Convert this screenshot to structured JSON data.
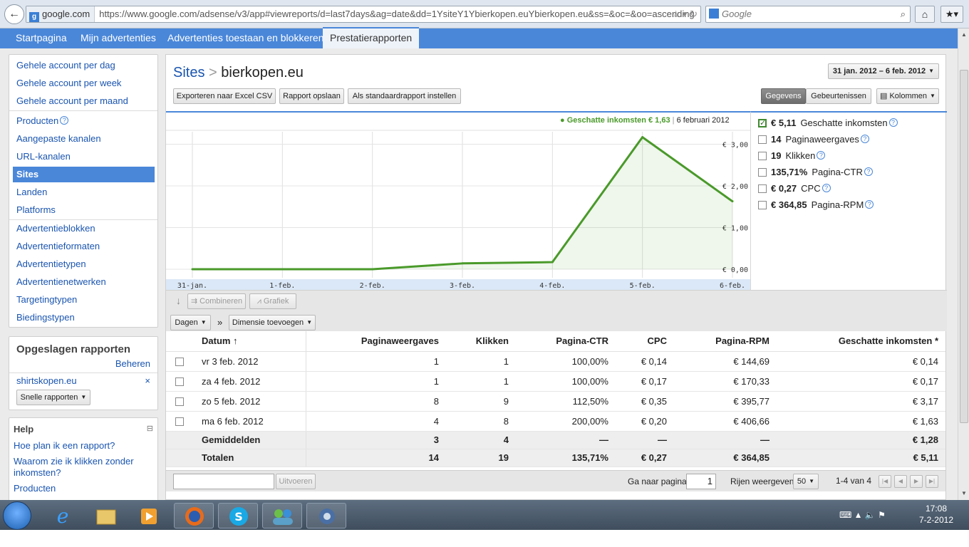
{
  "browser": {
    "site": "google.com",
    "url": "https://www.google.com/adsense/v3/app#viewreports/d=last7days&ag=date&dd=1YsiteY1Ybierkopen.euYbierkopen.eu&ss=&oc=&oo=ascending",
    "search_placeholder": "Google"
  },
  "nav": {
    "tabs": [
      "Startpagina",
      "Mijn advertenties",
      "Advertenties toestaan en blokkeren",
      "Prestatierapporten"
    ]
  },
  "sidebar": {
    "group1": [
      "Gehele account per dag",
      "Gehele account per week",
      "Gehele account per maand"
    ],
    "group2": [
      "Producten",
      "Aangepaste kanalen",
      "URL-kanalen",
      "Sites",
      "Landen",
      "Platforms"
    ],
    "group3": [
      "Advertentieblokken",
      "Advertentieformaten",
      "Advertentietypen",
      "Advertentienetwerken",
      "Targetingtypen",
      "Biedingstypen"
    ]
  },
  "saved": {
    "title": "Opgeslagen rapporten",
    "manage": "Beheren",
    "item": "shirtskopen.eu",
    "remove": "×",
    "quick": "Snelle rapporten"
  },
  "help": {
    "title": "Help",
    "collapse": "⊟",
    "links": [
      "Hoe plan ik een rapport?",
      "Waarom zie ik klikken zonder inkomsten?",
      "Producten"
    ]
  },
  "report": {
    "crumb_root": "Sites",
    "crumb_sep": ">",
    "crumb_current": "bierkopen.eu",
    "date_range": "31 jan. 2012 – 6 feb. 2012",
    "buttons": [
      "Exporteren naar Excel CSV",
      "Rapport opslaan",
      "Als standaardrapport instellen"
    ],
    "view_toggle": [
      "Gegevens",
      "Gebeurtenissen"
    ],
    "columns_btn": "Kolommen",
    "tooltip_series": "● Geschatte inkomsten € 1,63",
    "tooltip_date": "6 februari 2012",
    "combine": "Combineren",
    "graph": "Grafiek",
    "dim_days": "Dagen",
    "dim_add": "Dimensie toevoegen",
    "dim_sep": "»"
  },
  "metrics": [
    {
      "value": "€ 5,11",
      "label": "Geschatte inkomsten",
      "checked": true
    },
    {
      "value": "14",
      "label": "Paginaweergaves",
      "checked": false
    },
    {
      "value": "19",
      "label": "Klikken",
      "checked": false
    },
    {
      "value": "135,71%",
      "label": "Pagina-CTR",
      "checked": false
    },
    {
      "value": "€ 0,27",
      "label": "CPC",
      "checked": false
    },
    {
      "value": "€ 364,85",
      "label": "Pagina-RPM",
      "checked": false
    }
  ],
  "chart_data": {
    "type": "area",
    "x": [
      "31-jan.",
      "1-feb.",
      "2-feb.",
      "3-feb.",
      "4-feb.",
      "5-feb.",
      "6-feb."
    ],
    "series": [
      {
        "name": "Geschatte inkomsten",
        "values": [
          0.0,
          0.0,
          0.0,
          0.14,
          0.17,
          3.17,
          1.63
        ]
      }
    ],
    "yticks": [
      "€ 3,00",
      "€ 2,00",
      "€ 1,00",
      "€ 0,00"
    ],
    "ylim": [
      0,
      3.3
    ],
    "grid": true,
    "color": "#4a9a2a"
  },
  "table": {
    "headers": [
      "Datum ↑",
      "Paginaweergaves",
      "Klikken",
      "Pagina-CTR",
      "CPC",
      "Pagina-RPM",
      "Geschatte inkomsten *"
    ],
    "rows": [
      [
        "vr 3 feb. 2012",
        "1",
        "1",
        "100,00%",
        "€ 0,14",
        "€ 144,69",
        "€ 0,14"
      ],
      [
        "za 4 feb. 2012",
        "1",
        "1",
        "100,00%",
        "€ 0,17",
        "€ 170,33",
        "€ 0,17"
      ],
      [
        "zo 5 feb. 2012",
        "8",
        "9",
        "112,50%",
        "€ 0,35",
        "€ 395,77",
        "€ 3,17"
      ],
      [
        "ma 6 feb. 2012",
        "4",
        "8",
        "200,00%",
        "€ 0,20",
        "€ 406,66",
        "€ 1,63"
      ]
    ],
    "averages": [
      "Gemiddelden",
      "3",
      "4",
      "—",
      "—",
      "—",
      "€ 1,28"
    ],
    "totals": [
      "Totalen",
      "14",
      "19",
      "135,71%",
      "€ 0,27",
      "€ 364,85",
      "€ 5,11"
    ]
  },
  "pager": {
    "run": "Uitvoeren",
    "goto_label": "Ga naar pagina:",
    "page": "1",
    "rows_label": "Rijen weergeven:",
    "rows_value": "50",
    "range": "1-4 van 4"
  },
  "taskbar": {
    "time": "17:08",
    "date": "7-2-2012"
  }
}
